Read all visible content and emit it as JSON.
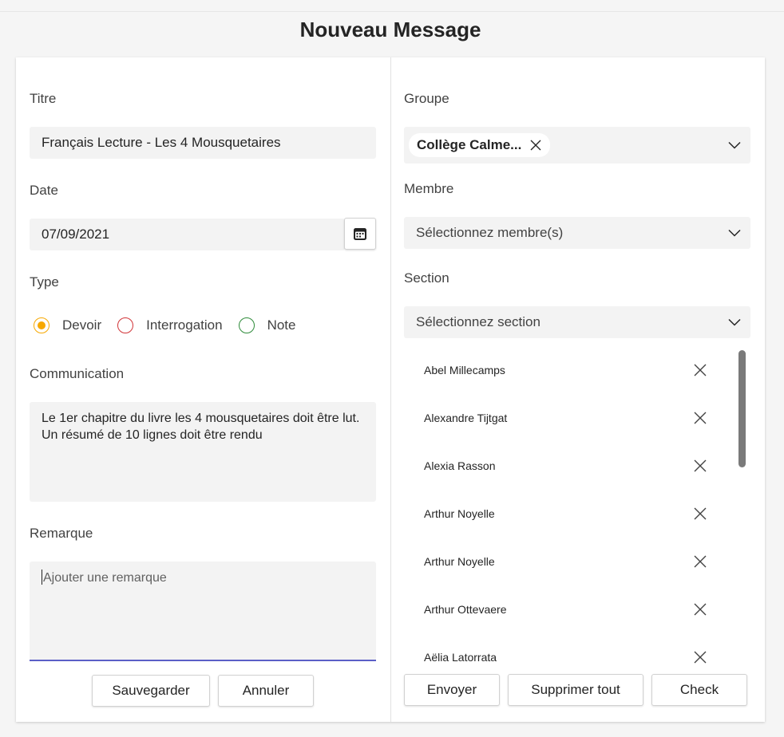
{
  "page": {
    "title": "Nouveau Message"
  },
  "form": {
    "titre_label": "Titre",
    "titre_value": "Français Lecture - Les 4 Mousquetaires",
    "date_label": "Date",
    "date_value": "07/09/2021",
    "type_label": "Type",
    "types": [
      {
        "label": "Devoir",
        "color": "#f7a800",
        "selected": true
      },
      {
        "label": "Interrogation",
        "color": "#d13438",
        "selected": false
      },
      {
        "label": "Note",
        "color": "#2e8b3a",
        "selected": false
      }
    ],
    "communication_label": "Communication",
    "communication_value": "Le 1er chapitre du livre les 4 mousquetaires doit être lut.  Un résumé de 10 lignes doit être rendu",
    "remarque_label": "Remarque",
    "remarque_placeholder": "Ajouter une remarque",
    "save_label": "Sauvegarder",
    "cancel_label": "Annuler"
  },
  "right": {
    "groupe_label": "Groupe",
    "groupe_chip": "Collège Calme...",
    "membre_label": "Membre",
    "membre_placeholder": "Sélectionnez membre(s)",
    "section_label": "Section",
    "section_placeholder": "Sélectionnez section",
    "members": [
      "Abel Millecamps",
      "Alexandre Tijtgat",
      "Alexia Rasson",
      "Arthur Noyelle",
      "Arthur Noyelle",
      "Arthur Ottevaere",
      "Aëlia Latorrata"
    ],
    "send_label": "Envoyer",
    "delete_all_label": "Supprimer tout",
    "check_label": "Check"
  },
  "colors": {
    "accent": "#5b5fc7"
  },
  "icons": {
    "calendar": "calendar-icon",
    "chevron": "chevron-down-icon",
    "remove": "close-icon"
  }
}
